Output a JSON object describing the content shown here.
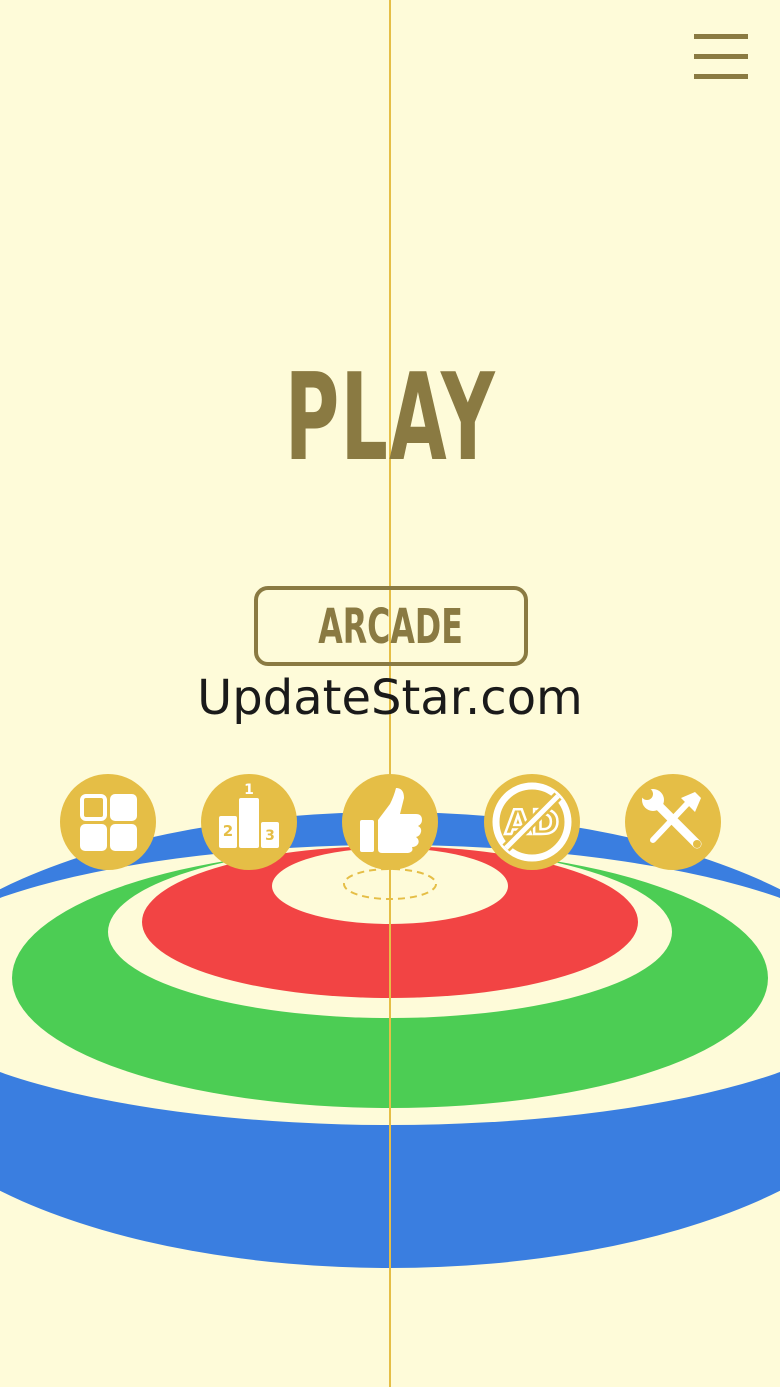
{
  "menu": {
    "icon": "hamburger-menu-icon"
  },
  "title": {
    "text": "PLAY"
  },
  "mode_button": {
    "label": "ARCADE"
  },
  "watermark": {
    "text": "UpdateStar.com"
  },
  "toolbar": {
    "icons": [
      "levels-grid-icon",
      "leaderboard-podium-icon",
      "thumbs-up-rate-icon",
      "no-ads-icon",
      "settings-tools-icon"
    ],
    "podium_labels": [
      "2",
      "1",
      "3"
    ],
    "no_ads_label": "AD"
  },
  "colors": {
    "background": "#fefbd9",
    "accent": "#8a7a42",
    "icon_circle": "#e5be46",
    "ring_red": "#f24444",
    "ring_green": "#4ccd54",
    "ring_blue": "#3a7ee0",
    "center_line": "#e5be46"
  }
}
